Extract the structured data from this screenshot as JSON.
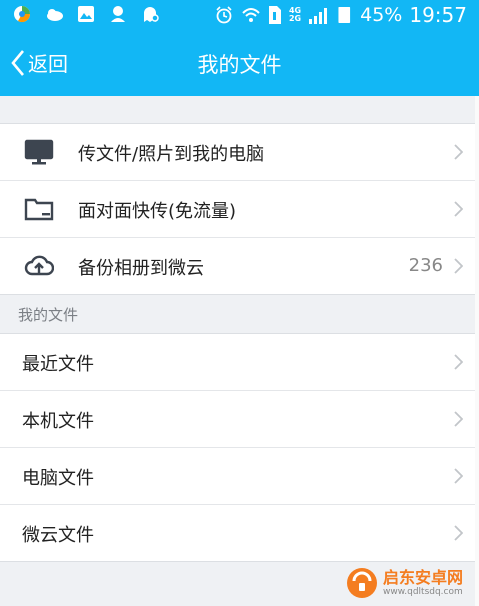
{
  "status_bar": {
    "battery_percent": "45%",
    "time": "19:57",
    "network_top": "4G",
    "network_bottom": "2G",
    "icons": [
      "browser-icon",
      "weather-icon",
      "gallery-icon",
      "app-icon",
      "ghost-icon",
      "alarm-icon",
      "wifi-icon",
      "sim-icon",
      "signal-icon",
      "battery-icon"
    ]
  },
  "nav": {
    "back_label": "返回",
    "title": "我的文件"
  },
  "group_main": [
    {
      "icon": "monitor-icon",
      "label": "传文件/照片到我的电脑",
      "count": ""
    },
    {
      "icon": "folder-icon",
      "label": "面对面快传(免流量)",
      "count": ""
    },
    {
      "icon": "cloud-upload-icon",
      "label": "备份相册到微云",
      "count": "236"
    }
  ],
  "section_title": "我的文件",
  "group_files": [
    {
      "label": "最近文件"
    },
    {
      "label": "本机文件"
    },
    {
      "label": "电脑文件"
    },
    {
      "label": "微云文件"
    }
  ],
  "watermark": {
    "name": "启东安卓网",
    "url": "www.qdltsdq.com"
  },
  "colors": {
    "accent": "#12b7f5",
    "background": "#eff1f4",
    "watermark_orange": "#f47d20"
  }
}
